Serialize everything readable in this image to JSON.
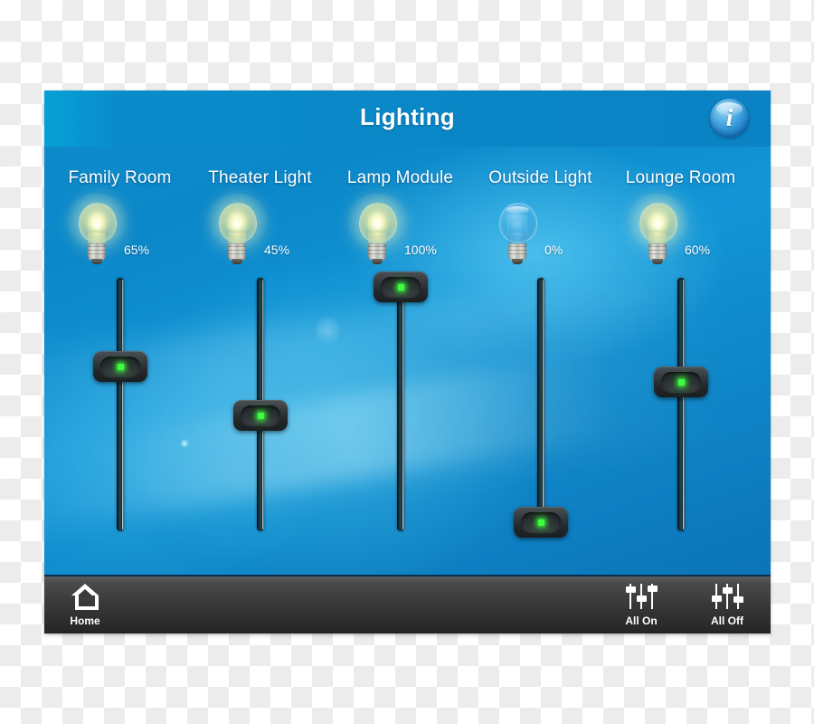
{
  "app": {
    "title": "Lighting",
    "info_button": {
      "name": "info-button",
      "glyph": "i"
    }
  },
  "channels": [
    {
      "label": "Family Room",
      "percent_text": "65%",
      "percent_value": 65,
      "state": "on",
      "led": "green"
    },
    {
      "label": "Theater Light",
      "percent_text": "45%",
      "percent_value": 45,
      "state": "on",
      "led": "green"
    },
    {
      "label": "Lamp Module",
      "percent_text": "100%",
      "percent_value": 100,
      "state": "on",
      "led": "green"
    },
    {
      "label": "Outside Light",
      "percent_text": "0%",
      "percent_value": 0,
      "state": "off",
      "led": "green"
    },
    {
      "label": "Lounge Room",
      "percent_text": "60%",
      "percent_value": 60,
      "state": "on",
      "led": "green"
    }
  ],
  "toolbar": {
    "home": {
      "label": "Home",
      "icon": "house-icon"
    },
    "all_on": {
      "label": "All On",
      "icon": "faders-up-icon"
    },
    "all_off": {
      "label": "All Off",
      "icon": "faders-down-icon"
    }
  },
  "colors": {
    "panel_blue": "#0d8ccb",
    "header_blue": "#0a86c6",
    "toolbar_dark": "#3a3a3a",
    "led_green": "#3dff3d",
    "bulb_on_glass": "#eeeca6",
    "bulb_off_glass": "#50afe1",
    "text_white": "#ffffff"
  }
}
